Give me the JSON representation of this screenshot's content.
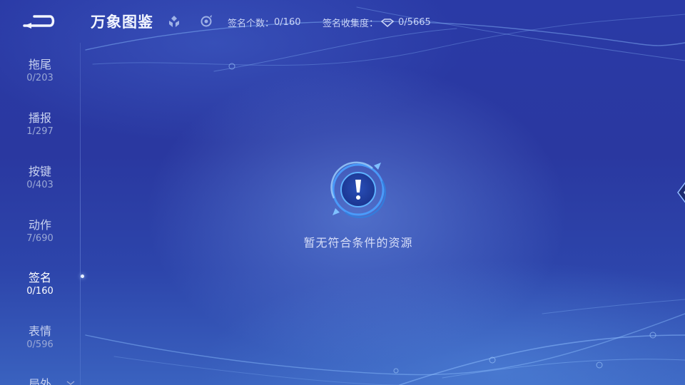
{
  "header": {
    "title": "万象图鉴",
    "icons": [
      "hero-filter-icon",
      "skin-filter-icon"
    ],
    "stats": [
      {
        "label": "签名个数：",
        "value": "0/160"
      },
      {
        "label": "签名收集度：",
        "value": "0/5665",
        "icon": "diamond-icon"
      }
    ]
  },
  "sidebar": {
    "items": [
      {
        "label": "拖尾",
        "count": "0/203"
      },
      {
        "label": "播报",
        "count": "1/297"
      },
      {
        "label": "按键",
        "count": "0/403"
      },
      {
        "label": "动作",
        "count": "7/690"
      },
      {
        "label": "签名",
        "count": "0/160",
        "active": true
      },
      {
        "label": "表情",
        "count": "0/596"
      },
      {
        "label": "局外",
        "count": ""
      }
    ]
  },
  "main": {
    "empty_message": "暂无符合条件的资源",
    "empty_icon": "exclamation-icon"
  },
  "colors": {
    "background": "#2a3aa6",
    "accent": "#4aa0ff",
    "text_primary": "#f2f5ff",
    "text_secondary": "#c9d3f5"
  }
}
